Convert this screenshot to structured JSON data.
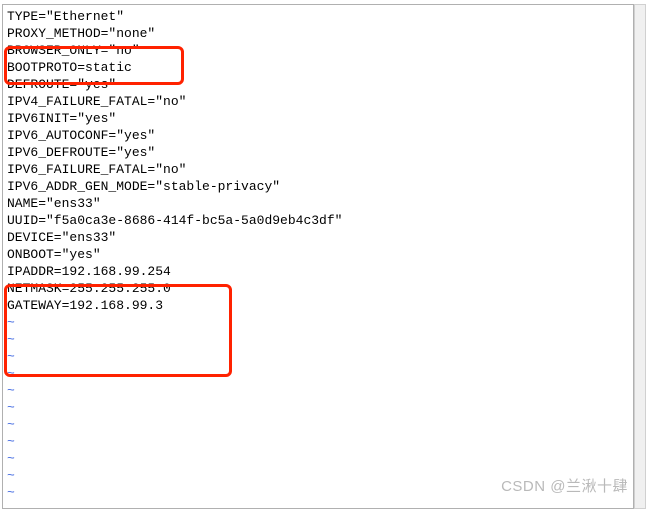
{
  "config_lines": [
    "TYPE=\"Ethernet\"",
    "PROXY_METHOD=\"none\"",
    "BROWSER_ONLY=\"no\"",
    "BOOTPROTO=static",
    "DEFROUTE=\"yes\"",
    "IPV4_FAILURE_FATAL=\"no\"",
    "IPV6INIT=\"yes\"",
    "IPV6_AUTOCONF=\"yes\"",
    "IPV6_DEFROUTE=\"yes\"",
    "IPV6_FAILURE_FATAL=\"no\"",
    "IPV6_ADDR_GEN_MODE=\"stable-privacy\"",
    "NAME=\"ens33\"",
    "UUID=\"f5a0ca3e-8686-414f-bc5a-5a0d9eb4c3df\"",
    "DEVICE=\"ens33\"",
    "ONBOOT=\"yes\"",
    "IPADDR=192.168.99.254",
    "NETMASK=255.255.255.0",
    "GATEWAY=192.168.99.3"
  ],
  "tilde_lines": [
    "~",
    "~",
    "~",
    "~",
    "~",
    "~",
    "~",
    "~",
    "~",
    "~",
    "~"
  ],
  "watermark": "CSDN @兰湫十肆"
}
